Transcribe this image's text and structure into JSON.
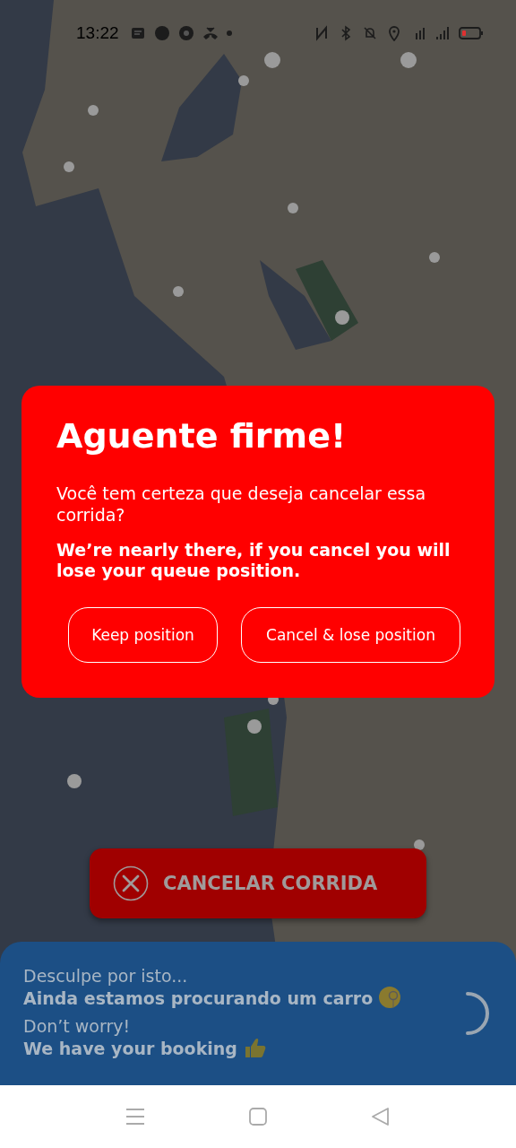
{
  "status_bar": {
    "time": "13:22"
  },
  "dialog": {
    "title": "Aguente firme!",
    "message": "Você tem certeza que deseja cancelar essa corrida?",
    "warning": "We’re nearly there, if you cancel you will lose your queue position.",
    "buttons": [
      "Keep position",
      "Cancel & lose position"
    ]
  },
  "cancel_button": {
    "label": "CANCELAR CORRIDA"
  },
  "status_panel": {
    "messages": [
      {
        "kind": "searching",
        "heading": "Desculpe por isto...",
        "body": "Ainda estamos procurando um carro"
      },
      {
        "kind": "booked",
        "heading": "Don’t worry!",
        "body": "We have your booking"
      }
    ]
  }
}
